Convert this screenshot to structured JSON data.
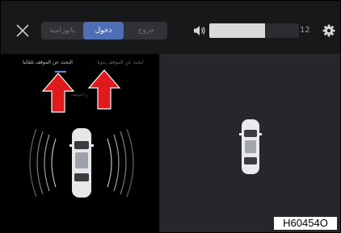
{
  "topbar": {
    "tabs": [
      {
        "label": "بانورامية",
        "active": false
      },
      {
        "label": "دخول",
        "active": true
      },
      {
        "label": "خروج",
        "active": false
      }
    ],
    "volume": {
      "value": "12",
      "level": 0.62
    },
    "icons": {
      "close": "close-icon",
      "volume": "speaker-icon",
      "settings": "gear-icon"
    }
  },
  "parking_panel": {
    "options": [
      {
        "label": "البحث عن الموقف تلقائيا",
        "selected": true
      },
      {
        "label": "ابحث عن الموقف يدويا",
        "selected": false
      }
    ],
    "hint_text": "ح الموقف"
  },
  "figure_code": "H60454O",
  "colors": {
    "accent": "#4e6fb5",
    "arrow": "#e0191c",
    "panel_bg": "#000000",
    "map_bg": "#26272a"
  }
}
